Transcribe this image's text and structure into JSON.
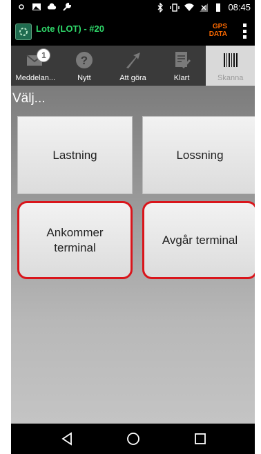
{
  "status_bar": {
    "time": "08:45",
    "icons_left": [
      "notification-dot-icon",
      "image-icon",
      "cloud-icon",
      "wrench-icon"
    ],
    "icons_right": [
      "bluetooth-icon",
      "vibrate-icon",
      "wifi-icon",
      "signal-icon",
      "battery-icon"
    ]
  },
  "app_header": {
    "title": "Lote (LOT) - #20",
    "gps_line1": "GPS",
    "gps_line2": "DATA",
    "title_color": "#2fd86a",
    "gps_color": "#ff6a00"
  },
  "tabs": [
    {
      "label": "Meddelan...",
      "icon": "envelope-icon",
      "badge": "1",
      "active": false
    },
    {
      "label": "Nytt",
      "icon": "question-icon",
      "active": false
    },
    {
      "label": "Att göra",
      "icon": "arrow-icon",
      "active": false
    },
    {
      "label": "Klart",
      "icon": "checklist-icon",
      "active": false
    },
    {
      "label": "Skanna",
      "icon": "barcode-icon",
      "active": true
    }
  ],
  "main": {
    "section_title": "Välj...",
    "buttons": [
      {
        "label": "Lastning"
      },
      {
        "label": "Lossning"
      },
      {
        "label_line1": "Ankommer",
        "label_line2": "terminal",
        "highlighted": true
      },
      {
        "label": "Avgår terminal",
        "highlighted": true
      }
    ],
    "highlight_color": "#d9151b"
  },
  "nav_bar": {
    "items": [
      "back-icon",
      "home-icon",
      "recents-icon"
    ]
  }
}
